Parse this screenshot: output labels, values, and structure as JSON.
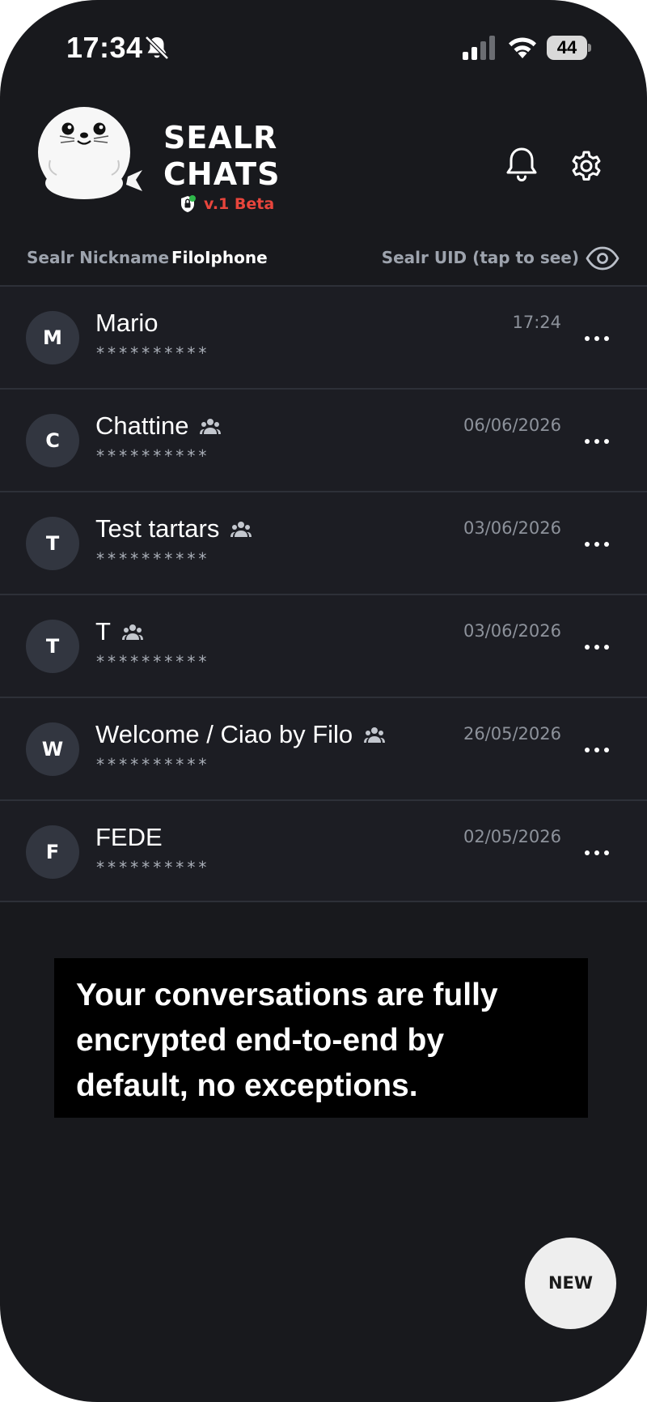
{
  "status_bar": {
    "time": "17:34",
    "battery": "44",
    "icons": [
      "bell-off-icon",
      "signal-icon",
      "wifi-icon",
      "battery-icon"
    ]
  },
  "header": {
    "title_line1": "SEALR",
    "title_line2": "CHATS",
    "version": "v.1 Beta",
    "icons": [
      "seal-logo",
      "lock-badge-icon",
      "bell-icon",
      "gear-icon"
    ],
    "version_color": "#e8453c"
  },
  "identity": {
    "nickname_label": "Sealr Nickname",
    "nickname_value": "FiloIphone",
    "uid_label": "Sealr UID (tap to see)",
    "uid_icon": "eye-icon"
  },
  "chats": [
    {
      "initial": "M",
      "name": "Mario",
      "time": "17:24",
      "preview": "**********",
      "group": false
    },
    {
      "initial": "C",
      "name": "Chattine",
      "time": "06/06/2026",
      "preview": "**********",
      "group": true
    },
    {
      "initial": "T",
      "name": "Test tartars",
      "time": "03/06/2026",
      "preview": "**********",
      "group": true
    },
    {
      "initial": "T",
      "name": "T",
      "time": "03/06/2026",
      "preview": "**********",
      "group": true
    },
    {
      "initial": "W",
      "name": "Welcome / Ciao by Filo",
      "time": "26/05/2026",
      "preview": "**********",
      "group": true
    },
    {
      "initial": "F",
      "name": "FEDE",
      "time": "02/05/2026",
      "preview": "**********",
      "group": false
    }
  ],
  "banner": {
    "line1": "Your conversations are fully",
    "line2": "encrypted end-to-end by",
    "line3": "default, no exceptions."
  },
  "new_button": {
    "label": "NEW"
  },
  "colors": {
    "background": "#18191d",
    "row_background": "#1c1d23",
    "divider": "#2d3038",
    "avatar": "#323640",
    "accent_red": "#e8453c"
  }
}
